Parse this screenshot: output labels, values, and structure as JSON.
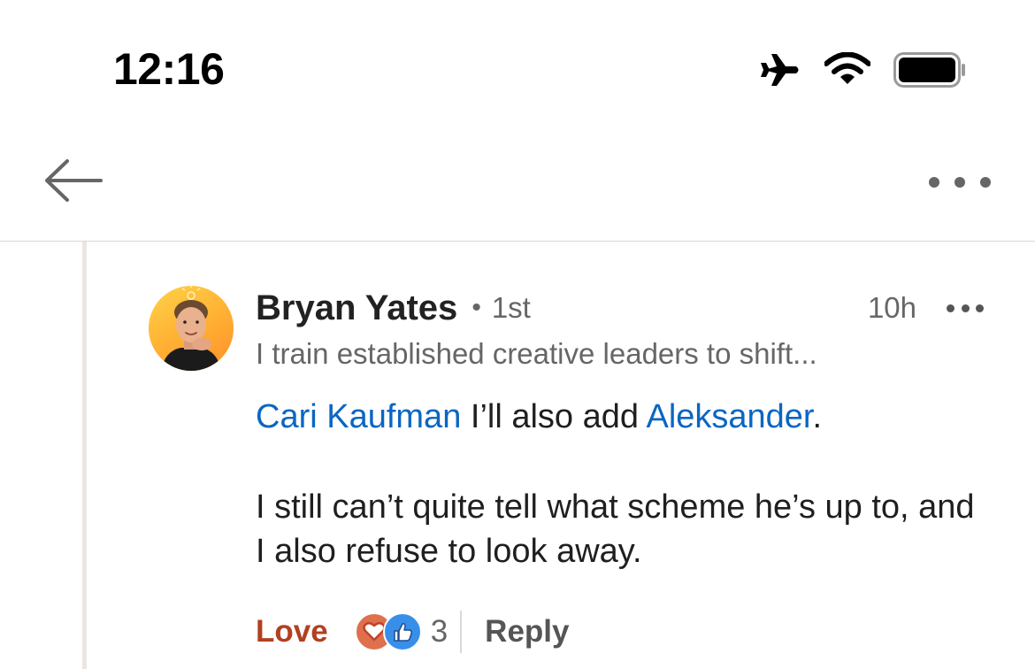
{
  "status_bar": {
    "time": "12:16",
    "icons": [
      "airplane-icon",
      "wifi-icon",
      "battery-icon"
    ]
  },
  "nav": {
    "back_icon": "arrow-left-icon",
    "more_icon": "more-horizontal-icon"
  },
  "comment": {
    "author": "Bryan Yates",
    "degree": "1st",
    "degree_separator": "•",
    "headline": "I train established creative leaders to shift...",
    "time": "10h",
    "body": {
      "mention_1": "Cari Kaufman",
      "text_1": " I’ll also add ",
      "mention_2": "Aleksander",
      "text_2": ".",
      "paragraph_2": "I still can’t quite tell what scheme he’s up to, and I also refuse to look away."
    },
    "actions": {
      "reaction_label": "Love",
      "reaction_icons": [
        "love-reaction-icon",
        "like-reaction-icon"
      ],
      "reaction_count": "3",
      "reply_label": "Reply"
    }
  },
  "colors": {
    "mention": "#0a66c2",
    "love": "#b24020",
    "like": "#378fe9",
    "love_icon_bg": "#df704d",
    "thread_line": "#ece6e1"
  }
}
